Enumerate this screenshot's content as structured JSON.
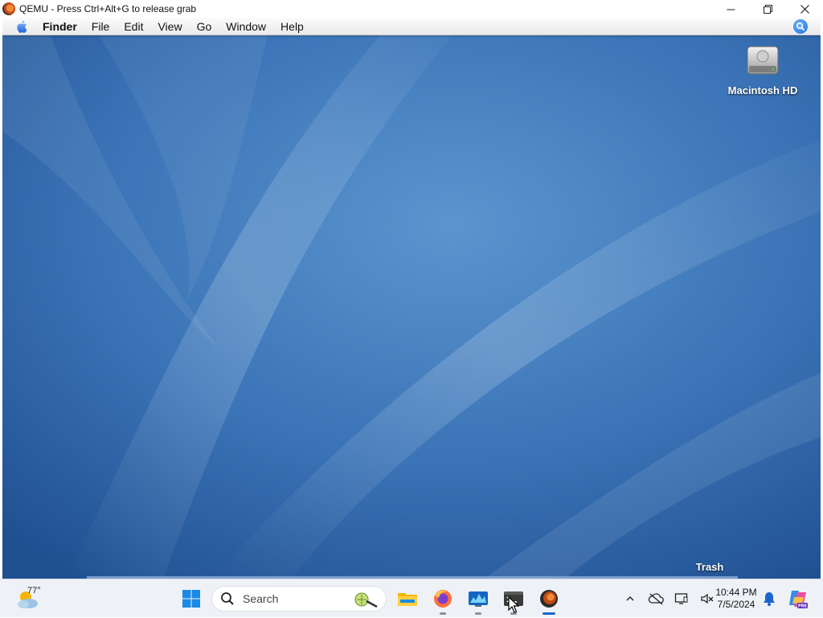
{
  "qemu_window": {
    "title": "QEMU - Press Ctrl+Alt+G to release grab",
    "controls": {
      "minimize": "—",
      "restore": "❐",
      "close": "✕"
    }
  },
  "mac_menubar": {
    "apple_icon": "apple-logo-icon",
    "items": [
      "Finder",
      "File",
      "Edit",
      "View",
      "Go",
      "Window",
      "Help"
    ],
    "spotlight_icon": "spotlight-search-icon"
  },
  "desktop": {
    "icons": [
      {
        "label": "Macintosh HD",
        "icon": "hard-drive-icon"
      },
      {
        "label": "Trash",
        "icon": "trash-icon"
      }
    ],
    "wallpaper_colors": {
      "base": "#2d63a8",
      "light": "#6aa3d6",
      "dark": "#1f4f91"
    }
  },
  "taskbar": {
    "weather": {
      "temp": "77°",
      "icon": "partly-cloudy-icon"
    },
    "start_icon": "windows-start-icon",
    "search": {
      "placeholder": "Search"
    },
    "apps": [
      {
        "name": "File Explorer",
        "icon": "folder-icon",
        "running": false
      },
      {
        "name": "Firefox",
        "icon": "firefox-icon",
        "running": true
      },
      {
        "name": "Resource Monitor",
        "icon": "monitor-chart-icon",
        "running": true
      },
      {
        "name": "Terminal",
        "icon": "terminal-icon",
        "running": true
      },
      {
        "name": "QEMU",
        "icon": "qemu-icon",
        "running": true,
        "active": true
      }
    ],
    "tray": {
      "chevron": "^"
    },
    "clock": {
      "time": "10:44 PM",
      "date": "7/5/2024"
    },
    "colors": {
      "accent": "#1a67c9",
      "bar": "#eef2f7"
    }
  }
}
